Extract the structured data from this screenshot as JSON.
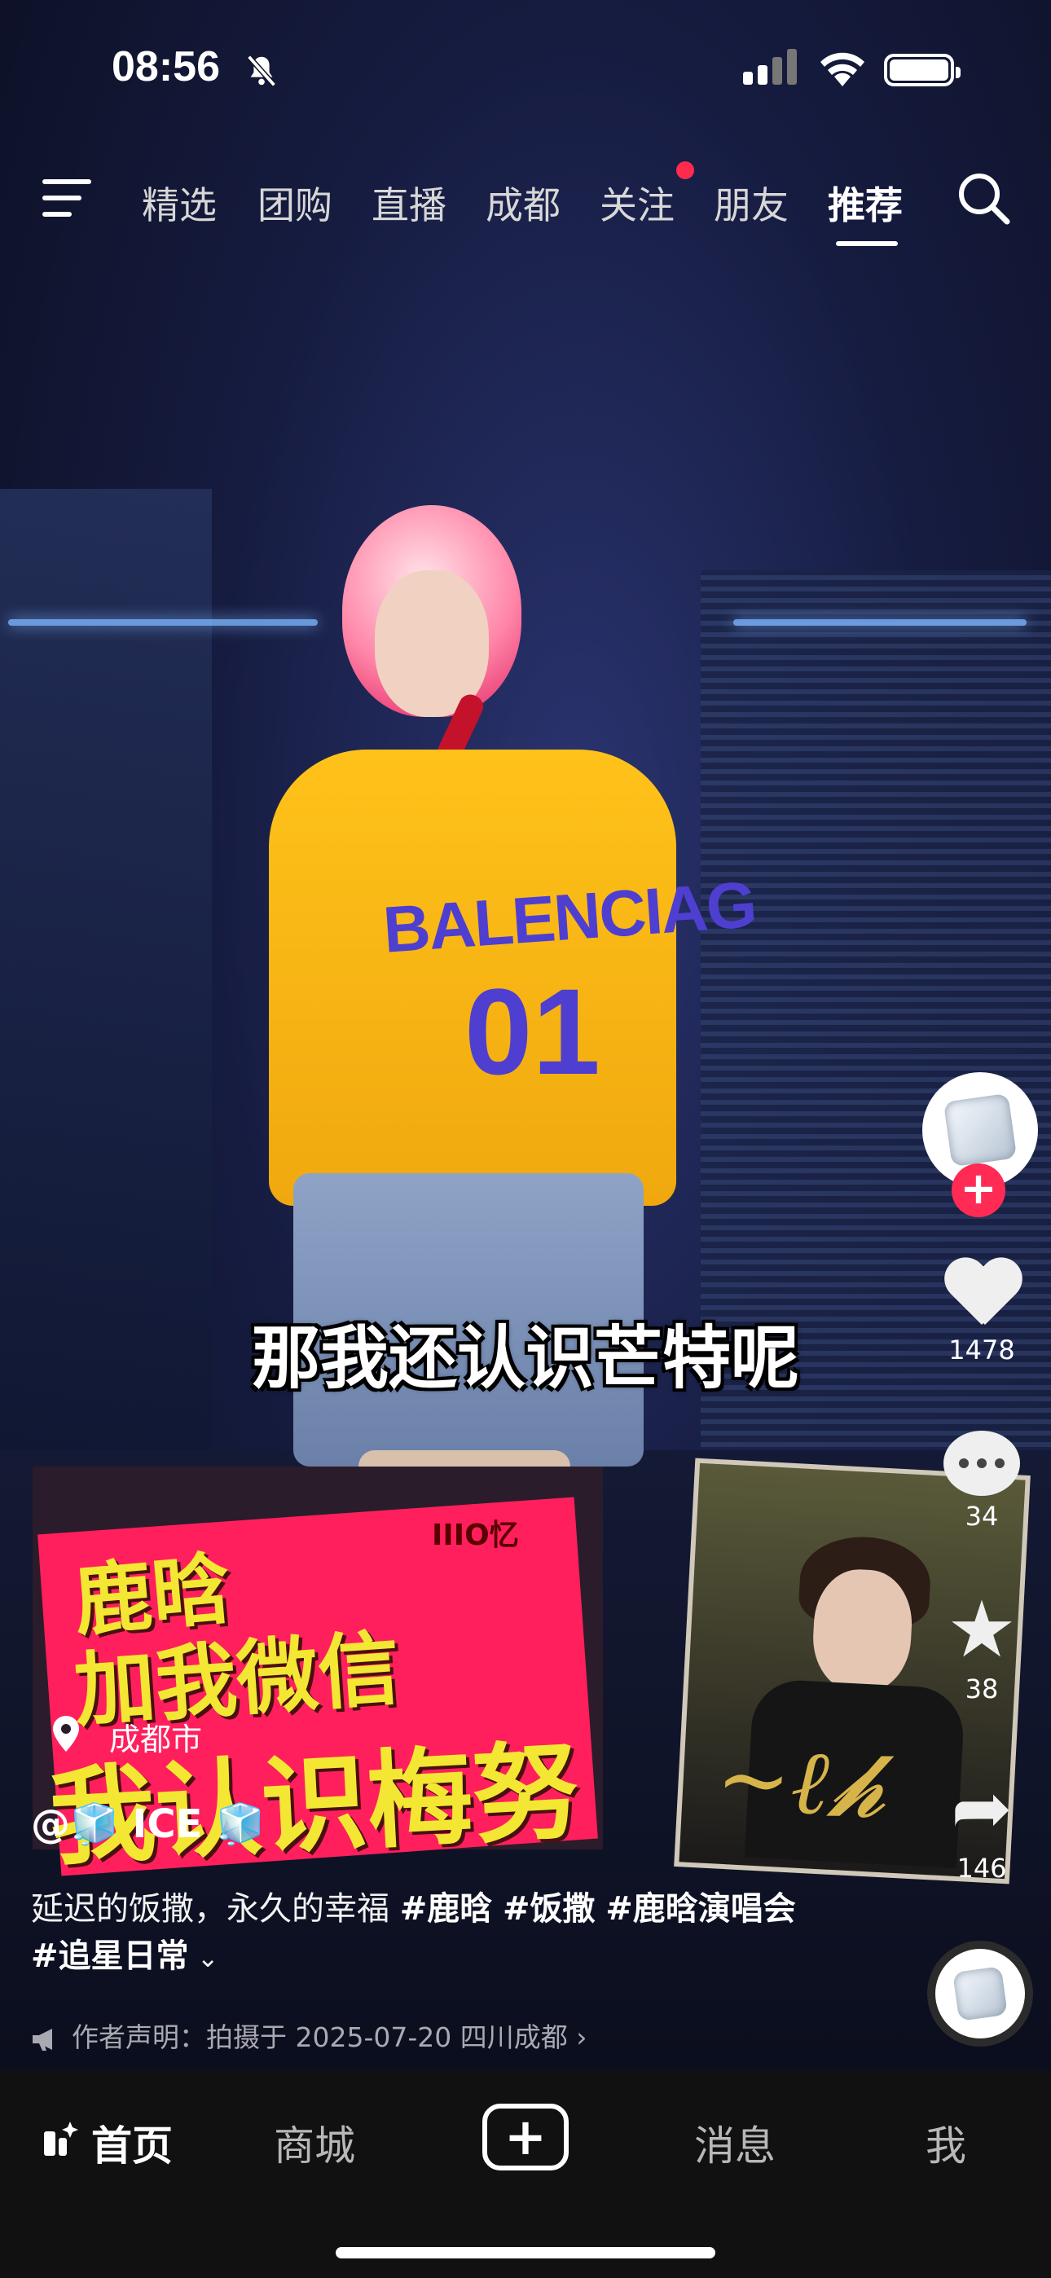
{
  "status_bar": {
    "time": "08:56"
  },
  "top_nav": {
    "tabs": [
      {
        "label": "精选"
      },
      {
        "label": "团购"
      },
      {
        "label": "直播"
      },
      {
        "label": "成都"
      },
      {
        "label": "关注"
      },
      {
        "label": "朋友"
      },
      {
        "label": "推荐",
        "active": true
      }
    ]
  },
  "video": {
    "subtitle": "那我还认识芒特呢",
    "shirt_text": "BALENCIAG",
    "shirt_number": "01",
    "sign_tag": "IIIO忆",
    "sign_line1": "鹿晗",
    "sign_line2": "加我微信",
    "sign_line3": "我认识梅努"
  },
  "right_rail": {
    "likes": "1478",
    "comments": "34",
    "favorites": "38",
    "shares": "146"
  },
  "info": {
    "location": "成都市",
    "author": "@🧊 ICE 🧊",
    "desc_text": "延迟的饭撒，永久的幸福 ",
    "hashtags": [
      "#鹿晗",
      "#饭撒",
      "#鹿晗演唱会",
      "#追星日常"
    ],
    "statement": "作者声明：拍摄于 2025-07-20 四川成都"
  },
  "bottom_nav": {
    "home": "首页",
    "mall": "商城",
    "messages": "消息",
    "me": "我"
  },
  "colors": {
    "accent": "#ff2b55",
    "shirt": "#ffc21a",
    "sign": "#ff1f5d"
  }
}
